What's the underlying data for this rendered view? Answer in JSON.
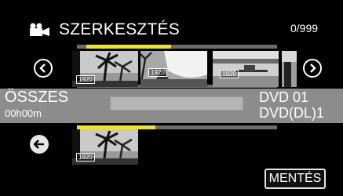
{
  "header": {
    "title": "SZERKESZTÉS",
    "counter": "0/999",
    "mode_icon": "video-camera-icon"
  },
  "filmstrip": {
    "prev_icon": "chevron-left-circle-icon",
    "next_icon": "chevron-right-circle-icon",
    "thumbnails": [
      {
        "badge": "1920",
        "scene": "palm-beach"
      },
      {
        "badge": "1920",
        "scene": "beach-sky"
      },
      {
        "badge": "1920",
        "scene": "lake-jetty"
      },
      {
        "badge": "",
        "scene": "partial"
      }
    ]
  },
  "info": {
    "total_label": "ÖSSZES",
    "total_time": "00h00m",
    "disc_line1": "DVD  01",
    "disc_line2": "DVD(DL)1"
  },
  "selected": {
    "back_icon": "back-arrow-circle-icon",
    "thumbnails": [
      {
        "badge": "1920",
        "scene": "palm-beach"
      }
    ]
  },
  "actions": {
    "save_label": "MENTÉS"
  },
  "colors": {
    "accent_yellow": "#f5e31a",
    "band_gray": "#8c8c8c",
    "background": "#000000"
  }
}
